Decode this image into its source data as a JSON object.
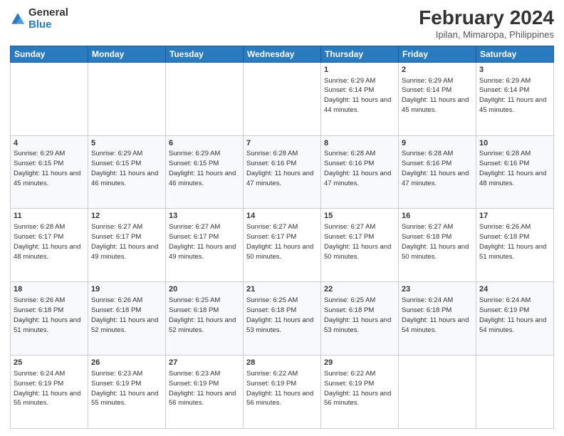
{
  "header": {
    "logo_general": "General",
    "logo_blue": "Blue",
    "title": "February 2024",
    "location": "Ipilan, Mimaropa, Philippines"
  },
  "weekdays": [
    "Sunday",
    "Monday",
    "Tuesday",
    "Wednesday",
    "Thursday",
    "Friday",
    "Saturday"
  ],
  "weeks": [
    [
      {
        "day": "",
        "info": ""
      },
      {
        "day": "",
        "info": ""
      },
      {
        "day": "",
        "info": ""
      },
      {
        "day": "",
        "info": ""
      },
      {
        "day": "1",
        "info": "Sunrise: 6:29 AM\nSunset: 6:14 PM\nDaylight: 11 hours and 44 minutes."
      },
      {
        "day": "2",
        "info": "Sunrise: 6:29 AM\nSunset: 6:14 PM\nDaylight: 11 hours and 45 minutes."
      },
      {
        "day": "3",
        "info": "Sunrise: 6:29 AM\nSunset: 6:14 PM\nDaylight: 11 hours and 45 minutes."
      }
    ],
    [
      {
        "day": "4",
        "info": "Sunrise: 6:29 AM\nSunset: 6:15 PM\nDaylight: 11 hours and 45 minutes."
      },
      {
        "day": "5",
        "info": "Sunrise: 6:29 AM\nSunset: 6:15 PM\nDaylight: 11 hours and 46 minutes."
      },
      {
        "day": "6",
        "info": "Sunrise: 6:29 AM\nSunset: 6:15 PM\nDaylight: 11 hours and 46 minutes."
      },
      {
        "day": "7",
        "info": "Sunrise: 6:28 AM\nSunset: 6:16 PM\nDaylight: 11 hours and 47 minutes."
      },
      {
        "day": "8",
        "info": "Sunrise: 6:28 AM\nSunset: 6:16 PM\nDaylight: 11 hours and 47 minutes."
      },
      {
        "day": "9",
        "info": "Sunrise: 6:28 AM\nSunset: 6:16 PM\nDaylight: 11 hours and 47 minutes."
      },
      {
        "day": "10",
        "info": "Sunrise: 6:28 AM\nSunset: 6:16 PM\nDaylight: 11 hours and 48 minutes."
      }
    ],
    [
      {
        "day": "11",
        "info": "Sunrise: 6:28 AM\nSunset: 6:17 PM\nDaylight: 11 hours and 48 minutes."
      },
      {
        "day": "12",
        "info": "Sunrise: 6:27 AM\nSunset: 6:17 PM\nDaylight: 11 hours and 49 minutes."
      },
      {
        "day": "13",
        "info": "Sunrise: 6:27 AM\nSunset: 6:17 PM\nDaylight: 11 hours and 49 minutes."
      },
      {
        "day": "14",
        "info": "Sunrise: 6:27 AM\nSunset: 6:17 PM\nDaylight: 11 hours and 50 minutes."
      },
      {
        "day": "15",
        "info": "Sunrise: 6:27 AM\nSunset: 6:17 PM\nDaylight: 11 hours and 50 minutes."
      },
      {
        "day": "16",
        "info": "Sunrise: 6:27 AM\nSunset: 6:18 PM\nDaylight: 11 hours and 50 minutes."
      },
      {
        "day": "17",
        "info": "Sunrise: 6:26 AM\nSunset: 6:18 PM\nDaylight: 11 hours and 51 minutes."
      }
    ],
    [
      {
        "day": "18",
        "info": "Sunrise: 6:26 AM\nSunset: 6:18 PM\nDaylight: 11 hours and 51 minutes."
      },
      {
        "day": "19",
        "info": "Sunrise: 6:26 AM\nSunset: 6:18 PM\nDaylight: 11 hours and 52 minutes."
      },
      {
        "day": "20",
        "info": "Sunrise: 6:25 AM\nSunset: 6:18 PM\nDaylight: 11 hours and 52 minutes."
      },
      {
        "day": "21",
        "info": "Sunrise: 6:25 AM\nSunset: 6:18 PM\nDaylight: 11 hours and 53 minutes."
      },
      {
        "day": "22",
        "info": "Sunrise: 6:25 AM\nSunset: 6:18 PM\nDaylight: 11 hours and 53 minutes."
      },
      {
        "day": "23",
        "info": "Sunrise: 6:24 AM\nSunset: 6:18 PM\nDaylight: 11 hours and 54 minutes."
      },
      {
        "day": "24",
        "info": "Sunrise: 6:24 AM\nSunset: 6:19 PM\nDaylight: 11 hours and 54 minutes."
      }
    ],
    [
      {
        "day": "25",
        "info": "Sunrise: 6:24 AM\nSunset: 6:19 PM\nDaylight: 11 hours and 55 minutes."
      },
      {
        "day": "26",
        "info": "Sunrise: 6:23 AM\nSunset: 6:19 PM\nDaylight: 11 hours and 55 minutes."
      },
      {
        "day": "27",
        "info": "Sunrise: 6:23 AM\nSunset: 6:19 PM\nDaylight: 11 hours and 56 minutes."
      },
      {
        "day": "28",
        "info": "Sunrise: 6:22 AM\nSunset: 6:19 PM\nDaylight: 11 hours and 56 minutes."
      },
      {
        "day": "29",
        "info": "Sunrise: 6:22 AM\nSunset: 6:19 PM\nDaylight: 11 hours and 56 minutes."
      },
      {
        "day": "",
        "info": ""
      },
      {
        "day": "",
        "info": ""
      }
    ]
  ]
}
